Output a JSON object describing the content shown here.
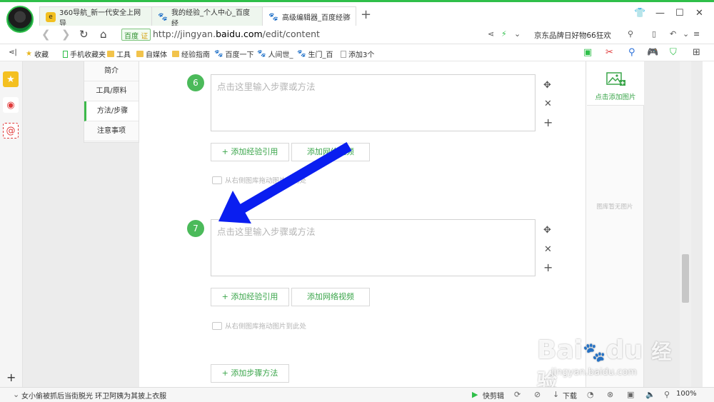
{
  "tabs": [
    {
      "title": "360导航_新一代安全上网导",
      "active": false
    },
    {
      "title": "我的经验_个人中心_百度经",
      "active": false
    },
    {
      "title": "高级编辑器_百度经验",
      "active": true
    }
  ],
  "address": {
    "site_id": "百度",
    "site_badge": "证",
    "url_prefix": "http://jingyan.",
    "url_domain": "baidu.com",
    "url_path": "/edit/content",
    "promo": "京东品牌日好物66狂欢"
  },
  "bookmarks": [
    {
      "label": "收藏",
      "icon": "star"
    },
    {
      "label": "手机收藏夹",
      "icon": "phone"
    },
    {
      "label": "工具",
      "icon": "folder"
    },
    {
      "label": "自媒体",
      "icon": "folder"
    },
    {
      "label": "经验指南",
      "icon": "folder"
    },
    {
      "label": "百度一下",
      "icon": "paw"
    },
    {
      "label": "人间世_",
      "icon": "paw"
    },
    {
      "label": "生门_百",
      "icon": "paw"
    },
    {
      "label": "添加3个",
      "icon": "page"
    }
  ],
  "outline": [
    "简介",
    "工具/原料",
    "方法/步骤",
    "注意事项"
  ],
  "steps": [
    {
      "number": "6",
      "placeholder": "点击这里输入步骤或方法"
    },
    {
      "number": "7",
      "placeholder": "点击这里输入步骤或方法"
    }
  ],
  "buttons": {
    "add_ref": "+ 添加经验引用",
    "add_video": "添加网络视频",
    "add_method": "+ 添加步骤方法"
  },
  "hint": "从右侧图库拖动图片到此处",
  "gallery": {
    "add_label": "点击添加图片",
    "empty": "图库暂无图片"
  },
  "watermark": {
    "logo": "Bai",
    "logo2": "du",
    "logo3": "经验",
    "url": "jingyan.baidu.com"
  },
  "status": {
    "news": "女小偷被抓后当街脱光 环卫阿姨为其披上衣服",
    "quick": "快剪辑",
    "download": "下载",
    "zoom": "100%"
  },
  "colors": {
    "accent": "#3aa54a",
    "step": "#4bba5a",
    "arrow": "#0a1ef0"
  }
}
